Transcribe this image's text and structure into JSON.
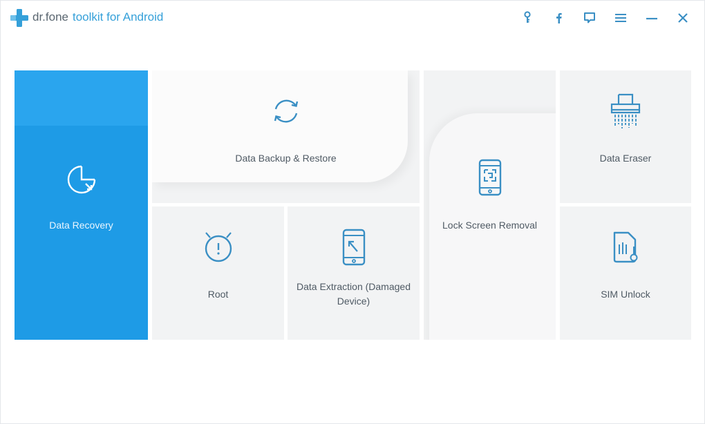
{
  "app": {
    "brand_name": "dr.fone",
    "product_name": "toolkit for Android"
  },
  "window_controls": [
    {
      "name": "key-icon"
    },
    {
      "name": "facebook-icon"
    },
    {
      "name": "feedback-icon"
    },
    {
      "name": "menu-icon"
    },
    {
      "name": "minimize-icon"
    },
    {
      "name": "close-icon"
    }
  ],
  "tiles": {
    "data_recovery": {
      "label": "Data Recovery",
      "icon": "pie-chart-icon"
    },
    "data_backup": {
      "label": "Data Backup & Restore",
      "icon": "sync-icon"
    },
    "lock_screen": {
      "label": "Lock Screen Removal",
      "icon": "phone-lock-icon"
    },
    "data_eraser": {
      "label": "Data Eraser",
      "icon": "shredder-icon"
    },
    "root": {
      "label": "Root",
      "icon": "android-root-icon"
    },
    "data_extraction": {
      "label": "Data Extraction (Damaged Device)",
      "icon": "phone-extract-icon"
    },
    "sim_unlock": {
      "label": "SIM Unlock",
      "icon": "sim-card-icon"
    }
  },
  "colors": {
    "accent": "#1e9be6",
    "icon": "#3a8fc4",
    "brand_text": "#35a0d9",
    "tile_bg": "#f2f3f4",
    "label_text": "#4f5a64"
  }
}
